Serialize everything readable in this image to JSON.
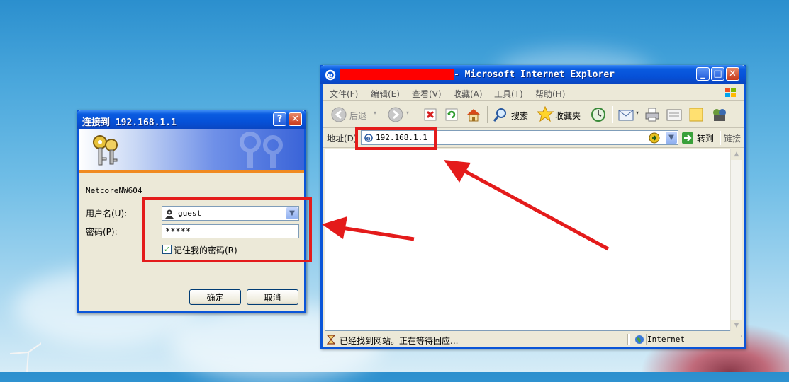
{
  "login_dialog": {
    "title": "连接到 192.168.1.1",
    "help_button": "?",
    "close_button": "✕",
    "realm": "NetcoreNW604",
    "username_label": "用户名(U):",
    "username_value": "guest",
    "password_label": "密码(P):",
    "password_value": "*****",
    "remember_label": "记住我的密码(R)",
    "remember_checked": true,
    "ok_label": "确定",
    "cancel_label": "取消"
  },
  "browser": {
    "title_suffix": "- Microsoft Internet Explorer",
    "menu": [
      "文件(F)",
      "编辑(E)",
      "查看(V)",
      "收藏(A)",
      "工具(T)",
      "帮助(H)"
    ],
    "toolbar": {
      "back_label": "后退",
      "search_label": "搜索",
      "favorites_label": "收藏夹"
    },
    "address_label": "地址(D)",
    "address_value": "192.168.1.1",
    "go_label": "转到",
    "links_label": "链接",
    "status_text": "已经找到网站。正在等待回应...",
    "zone_text": "Internet"
  },
  "annotation_color": "#e41b1b"
}
